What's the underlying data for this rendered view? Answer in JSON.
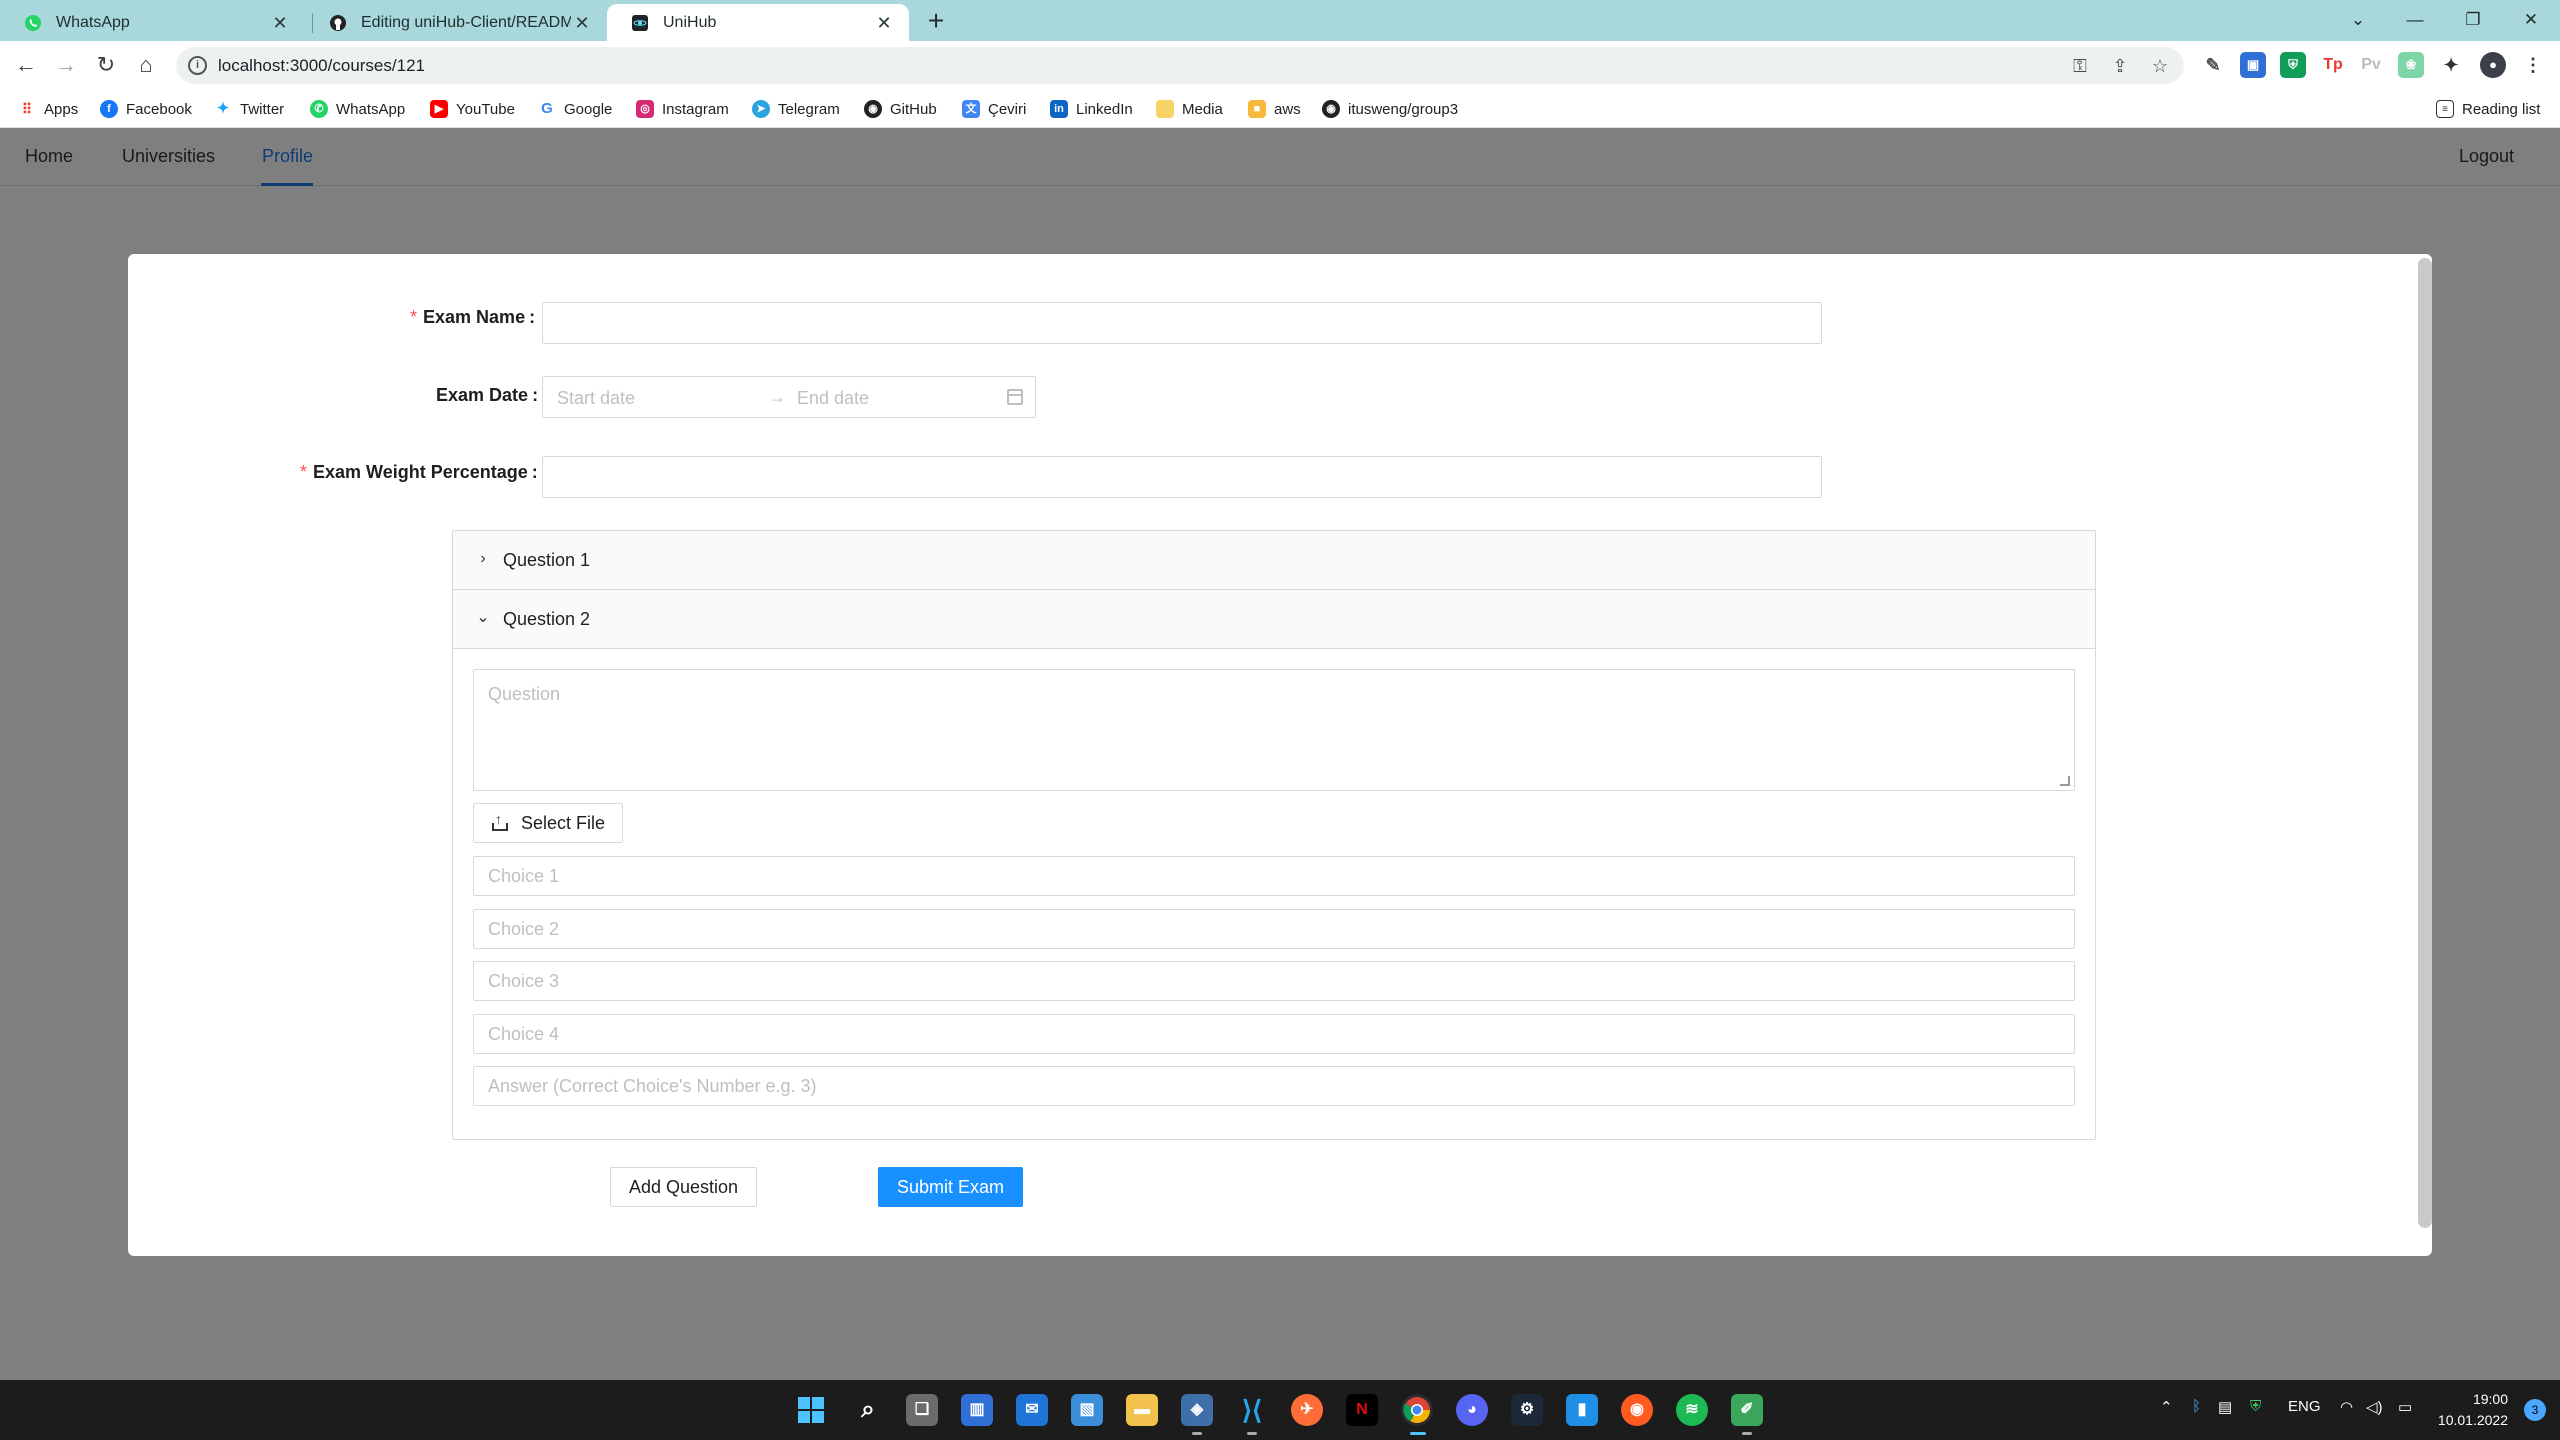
{
  "browser": {
    "tabs": [
      {
        "title": "WhatsApp",
        "active": false
      },
      {
        "title": "Editing uniHub-Client/README.m",
        "active": false
      },
      {
        "title": "UniHub",
        "active": true
      }
    ],
    "new_tab": "+",
    "url": "localhost:3000/courses/121",
    "reading_list": "Reading list",
    "bookmarks": [
      "Apps",
      "Facebook",
      "Twitter",
      "WhatsApp",
      "YouTube",
      "Google",
      "Instagram",
      "Telegram",
      "GitHub",
      "Çeviri",
      "LinkedIn",
      "Media",
      "aws",
      "itusweng/group3"
    ]
  },
  "nav": {
    "home": "Home",
    "universities": "Universities",
    "profile": "Profile",
    "logout": "Logout"
  },
  "form": {
    "exam_name_label": "Exam Name",
    "exam_date_label": "Exam Date",
    "exam_weight_label": "Exam Weight Percentage",
    "colon": ":",
    "required_mark": "*",
    "start_date_placeholder": "Start date",
    "end_date_placeholder": "End date",
    "date_arrow": "→",
    "questions": [
      {
        "title": "Question 1",
        "expanded": false
      },
      {
        "title": "Question 2",
        "expanded": true
      }
    ],
    "question_placeholder": "Question",
    "select_file": "Select File",
    "choices": [
      "Choice 1",
      "Choice 2",
      "Choice 3",
      "Choice 4"
    ],
    "answer_placeholder": "Answer (Correct Choice's Number e.g. 3)",
    "add_question": "Add Question",
    "submit_exam": "Submit Exam"
  },
  "taskbar": {
    "lang": "ENG",
    "time": "19:00",
    "date": "10.01.2022",
    "notifications": "3"
  },
  "colors": {
    "primary": "#1890ff",
    "required": "#ff4d4f",
    "tabstrip": "#a8d8db",
    "overlay": "#7f7f7f"
  }
}
